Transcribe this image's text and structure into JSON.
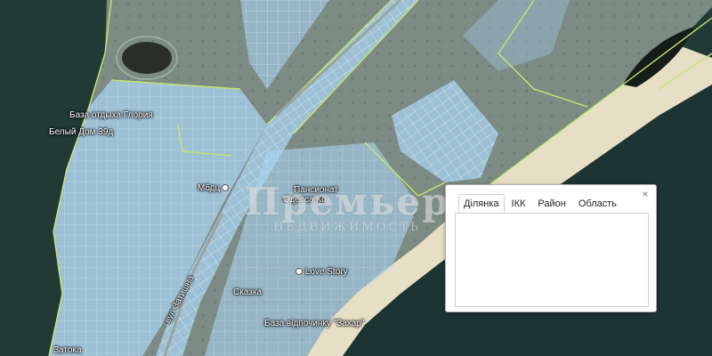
{
  "map": {
    "labels": [
      {
        "id": "baza-otdyha",
        "text": "База отдыха Глория"
      },
      {
        "id": "belyi-dom",
        "text": "Белый Дом 39д"
      },
      {
        "id": "mbdu",
        "text": "Мбдц"
      },
      {
        "id": "pansionat",
        "text": "Пансионат"
      },
      {
        "id": "pansionat-sub",
        "text": "Одесса Ко"
      },
      {
        "id": "love-story",
        "text": "Love Story"
      },
      {
        "id": "skazka",
        "text": "Сказка"
      },
      {
        "id": "baza-vidpochynku",
        "text": "База відпочинку \"Захар\""
      },
      {
        "id": "vul",
        "text": "вул Затишна"
      },
      {
        "id": "zatoka",
        "text": "Затока"
      }
    ]
  },
  "watermark": {
    "main": "Премьер",
    "sub": "НЕДВИЖИМОСТЬ"
  },
  "info_window": {
    "close": "×",
    "tabs": [
      "Ділянка",
      "ІКК",
      "Район",
      "Область"
    ],
    "active_tab": "Ділянка"
  },
  "colors": {
    "water": "#1f3734",
    "land": "#7a8c84",
    "cadastre_overlay": "#a9d3f2",
    "road_boundary": "#c8e86a",
    "beach": "#e8e1c8"
  }
}
